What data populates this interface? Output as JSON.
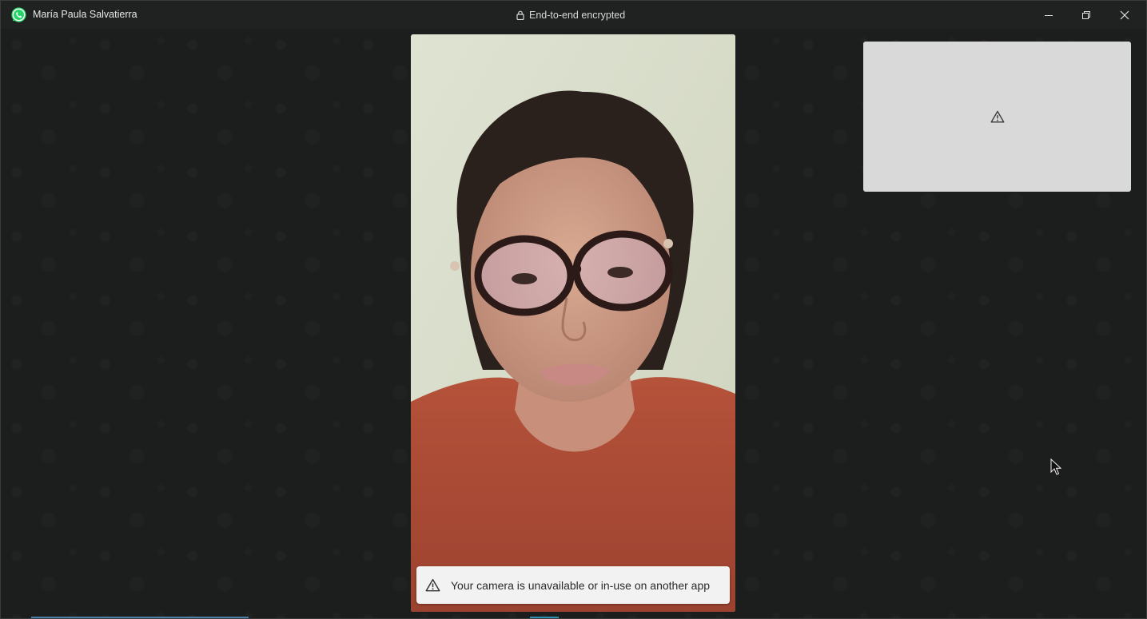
{
  "titlebar": {
    "app_icon": "whatsapp-icon",
    "contact_name": "María Paula Salvatierra",
    "encryption_label": "End-to-end encrypted",
    "encryption_icon": "lock-icon",
    "controls": {
      "minimize_icon": "minimize-icon",
      "restore_icon": "restore-icon",
      "close_icon": "close-icon"
    }
  },
  "call": {
    "remote_video": "remote-participant-video",
    "self_view_icon": "warning-icon",
    "camera_notice": {
      "icon": "warning-icon",
      "text": "Your camera is unavailable or in-use on another app"
    }
  },
  "colors": {
    "background": "#1c1d1d",
    "titlebar": "#202121",
    "toast_bg": "#f2f2f2",
    "self_view_bg": "#d9d9d9",
    "whatsapp_green": "#25d366"
  }
}
